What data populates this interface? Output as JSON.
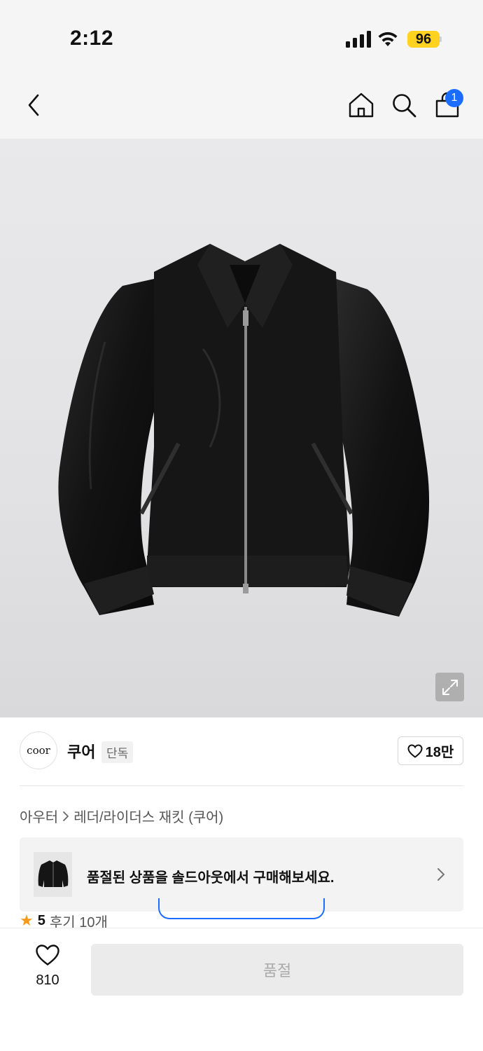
{
  "status_bar": {
    "time": "2:12",
    "battery": "96",
    "icons": [
      "cellular-signal-icon",
      "wifi-icon",
      "battery-icon"
    ]
  },
  "nav": {
    "icons": [
      "chevron-left-icon",
      "home-icon",
      "search-icon",
      "shopping-bag-icon"
    ],
    "cart_badge": "1"
  },
  "product": {
    "image_alt_icon": "leather-jacket-image",
    "zoom_icon": "expand-icon"
  },
  "brand": {
    "logo_text": "coor",
    "name": "쿠어",
    "tag": "단독",
    "likes": "18만"
  },
  "breadcrumb": {
    "category": "아우터",
    "subcategory": "레더/라이더스 재킷 (쿠어)"
  },
  "soldout_banner": {
    "text": "품절된 상품을 솔드아웃에서 구매해보세요."
  },
  "rating": {
    "score": "5",
    "reviews": "후기 10개"
  },
  "bottom_bar": {
    "wish_count": "810",
    "buy_label": "품절"
  },
  "colors": {
    "accent": "#1a6dff",
    "star": "#f59b1b",
    "battery": "#ffd21f"
  }
}
